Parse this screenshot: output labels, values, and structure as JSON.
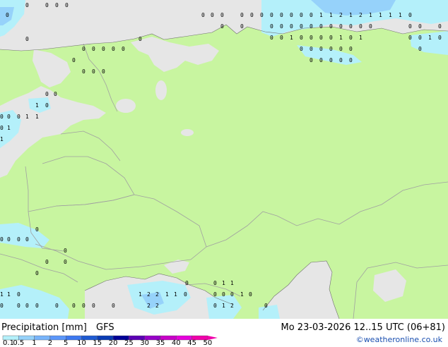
{
  "legend": {
    "title": "Precipitation [mm]",
    "model": "GFS",
    "ticks": [
      "0.1",
      "0.5",
      "1",
      "2",
      "5",
      "10",
      "15",
      "20",
      "25",
      "30",
      "35",
      "40",
      "45",
      "50"
    ],
    "colors": [
      "#b4f0fa",
      "#96d2fa",
      "#78b4fa",
      "#5a96fa",
      "#3c78f0",
      "#1e5ad2",
      "#0a3cb4",
      "#000096",
      "#5a00b4",
      "#9600c8",
      "#c800c8",
      "#e600dc",
      "#f000aa"
    ]
  },
  "datetime": "Mo 23-03-2026 12..15 UTC (06+81)",
  "credit": "©weatheronline.co.uk",
  "colors": {
    "land": "#c8f5a0",
    "sea": "#e6e6e6",
    "border": "#a0a0a0",
    "precip_light": "#b4f0fa",
    "precip_medium": "#96d2fa"
  }
}
